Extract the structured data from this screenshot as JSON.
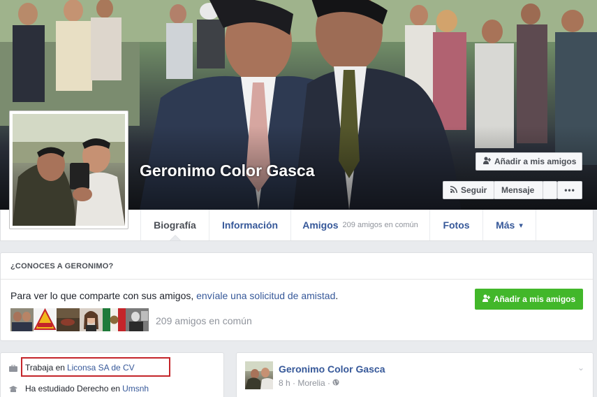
{
  "cover": {
    "profile_name": "Geronimo Color Gasca",
    "add_friend_label": "Añadir a mis amigos",
    "follow_label": "Seguir",
    "message_label": "Mensaje",
    "more_label": "•••"
  },
  "tabs": [
    {
      "label": "Biografía",
      "sub": ""
    },
    {
      "label": "Información",
      "sub": ""
    },
    {
      "label": "Amigos",
      "sub": "209 amigos en común"
    },
    {
      "label": "Fotos",
      "sub": ""
    },
    {
      "label": "Más",
      "sub": "▾"
    }
  ],
  "know": {
    "heading": "¿CONOCES A GERONIMO?",
    "text_prefix": "Para ver lo que comparte con sus amigos, ",
    "text_link": "envíale una solicitud de amistad",
    "text_suffix": ".",
    "add_friend_label": "Añadir a mis amigos",
    "mutual_count": "209 amigos en común"
  },
  "intro": {
    "work_prefix": "Trabaja en",
    "work_link": "Liconsa SA de CV",
    "study_prefix": "Ha estudiado Derecho en",
    "study_link": "Umsnh"
  },
  "post": {
    "author": "Geronimo Color Gasca",
    "meta": "8 h · Morelia · ",
    "chevron": "⌄"
  },
  "colors": {
    "link": "#365899",
    "green_button": "#42b72a",
    "highlight_border": "#c4252a",
    "page_bg": "#e9ebee"
  },
  "icons": {
    "add_friend": "add-friend-icon",
    "follow": "rss-icon",
    "work": "briefcase-icon",
    "study": "graduation-icon",
    "globe": "globe-icon"
  }
}
